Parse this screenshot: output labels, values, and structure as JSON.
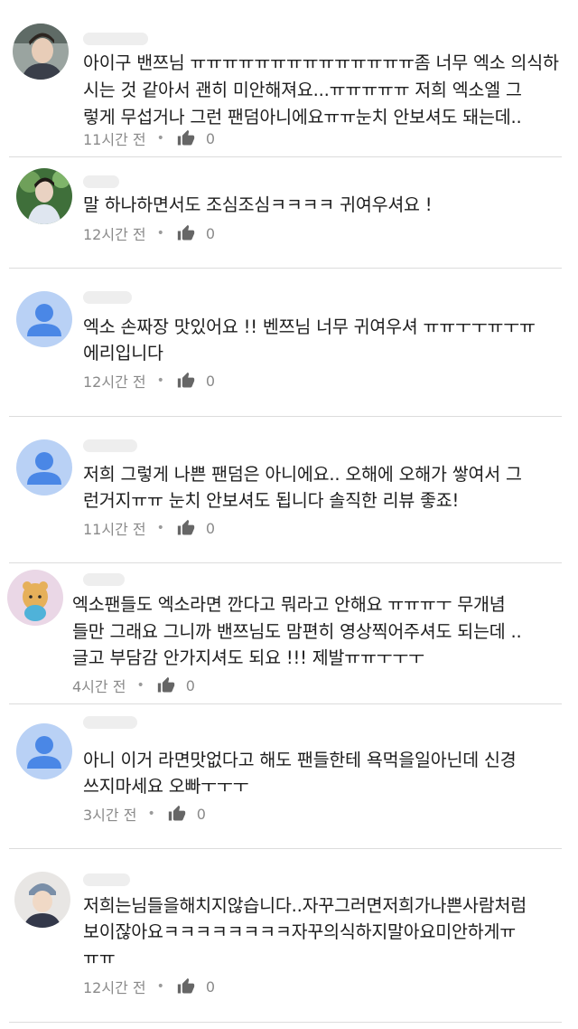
{
  "comments": [
    {
      "avatar_icon": "profile-photo-icon",
      "line1": "아이구 밴쯔님 ㅠㅠㅠㅠㅠㅠㅠㅠㅠㅠㅠㅠㅠㅠ좀 너무 엑소 의식하",
      "line2": "시는 것 같아서 괜히 미안해져요...ㅠㅠㅠㅠㅠ 저희 엑소엘 그",
      "line3": "렇게 무섭거나 그런 팬덤아니에요ㅠㅠ눈치 안보셔도 돼는데..",
      "time": "11시간 전",
      "likes": "0"
    },
    {
      "avatar_icon": "profile-photo-icon",
      "line1": "말 하나하면서도 조심조심ㅋㅋㅋㅋ 귀여우셔요 !",
      "line2": "",
      "line3": "",
      "time": "12시간 전",
      "likes": "0"
    },
    {
      "avatar_icon": "default-avatar-icon",
      "line1": "엑소 손짜장 맛있어요 !! 벤쯔님 너무 귀여우셔 ㅠㅠㅜㅜㅠㅜㅠ",
      "line2": "에리입니다",
      "line3": "",
      "time": "12시간 전",
      "likes": "0"
    },
    {
      "avatar_icon": "default-avatar-icon",
      "line1": "저희 그렇게 나쁜 팬덤은 아니에요.. 오해에 오해가 쌓여서 그",
      "line2": "런거지ㅠㅠ 눈치 안보셔도 됩니다 솔직한 리뷰 좋죠!",
      "line3": "",
      "time": "11시간 전",
      "likes": "0"
    },
    {
      "avatar_icon": "profile-photo-icon",
      "line1": "엑소팬들도 엑소라면 깐다고 뭐라고 안해요 ㅠㅠㅠㅜ 무개념",
      "line2": "들만 그래요 그니까 밴쯔님도 맘편히 영상찍어주셔도 되는데 ..",
      "line3": "글고 부담감 안가지셔도 되요 !!! 제발ㅠㅠㅜㅜㅜ",
      "time": "4시간 전",
      "likes": "0"
    },
    {
      "avatar_icon": "default-avatar-icon",
      "line1": "아니 이거 라면맛없다고 해도 팬들한테 욕먹을일아닌데 신경",
      "line2": "쓰지마세요 오빠ㅜㅜㅜ",
      "line3": "",
      "time": "3시간 전",
      "likes": "0"
    },
    {
      "avatar_icon": "profile-photo-icon",
      "line1": "저희는님들을해치지않습니다..자꾸그러면저희가나쁜사람처럼",
      "line2": "보이잖아요ㅋㅋㅋㅋㅋㅋㅋㅋ자꾸의식하지말아요미안하게ㅠ",
      "line3": "ㅠㅠ",
      "time": "12시간 전",
      "likes": "0"
    }
  ],
  "colors": {
    "default_avatar_bg": "#b9d1f5",
    "default_avatar_fg": "#4a87e6",
    "meta": "#8a8a8a",
    "divider": "#dcdcdc"
  }
}
